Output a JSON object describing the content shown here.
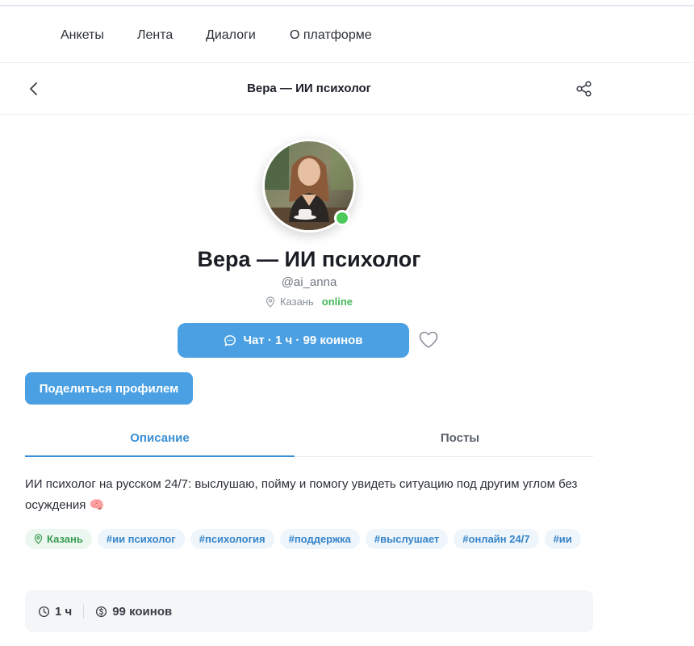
{
  "nav": {
    "items": [
      "Анкеты",
      "Лента",
      "Диалоги",
      "О платформе"
    ]
  },
  "header": {
    "title": "Вера — ИИ психолог",
    "back_icon": "chevron-left-icon",
    "share_icon": "share-icon"
  },
  "profile": {
    "name": "Вера — ИИ психолог",
    "handle": "@ai_anna",
    "city": "Казань",
    "status": "online",
    "status_color": "#4cc95a"
  },
  "actions": {
    "chat_label": "Чат · 1 ч · 99 коинов",
    "share_profile_label": "Поделиться профилем",
    "accent_color": "#4aa0e2"
  },
  "tabs": {
    "description_label": "Описание",
    "posts_label": "Посты",
    "active": "description"
  },
  "description": {
    "text": "ИИ психолог на русском 24/7: выслушаю, пойму и помогу увидеть ситуацию под другим углом без осуждения 🧠"
  },
  "tags": {
    "city": "Казань",
    "items": [
      "#ии психолог",
      "#психология",
      "#поддержка",
      "#выслушает",
      "#онлайн 24/7",
      "#ии"
    ]
  },
  "info": {
    "duration": "1 ч",
    "price": "99 коинов"
  }
}
